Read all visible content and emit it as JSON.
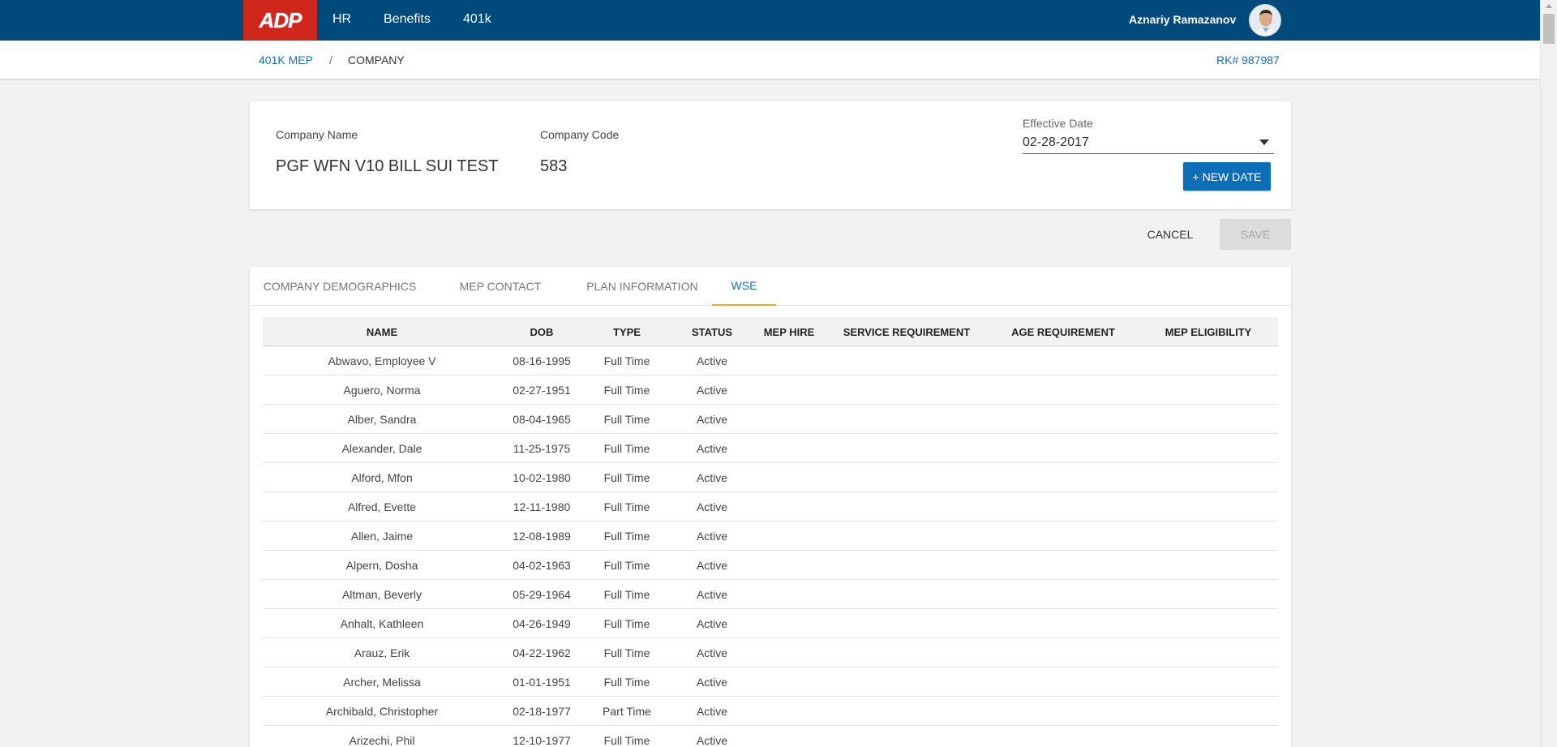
{
  "topbar": {
    "logo": "ADP",
    "nav": [
      "HR",
      "Benefits",
      "401k"
    ],
    "user_name": "Aznariy Ramazanov"
  },
  "breadcrumb": {
    "root": "401K MEP",
    "separator": "/",
    "current": "COMPANY",
    "rk": "RK# 987987"
  },
  "company": {
    "name_label": "Company Name",
    "name_value": "PGF WFN V10 BILL SUI TEST",
    "code_label": "Company Code",
    "code_value": "583",
    "effective_label": "Effective Date",
    "effective_value": "02-28-2017",
    "new_date_label": "+ NEW DATE"
  },
  "actions": {
    "cancel": "CANCEL",
    "save": "SAVE"
  },
  "tabs": [
    {
      "label": "COMPANY DEMOGRAPHICS",
      "active": false
    },
    {
      "label": "MEP CONTACT",
      "active": false
    },
    {
      "label": "PLAN INFORMATION",
      "active": false
    },
    {
      "label": "WSE",
      "active": true
    }
  ],
  "table": {
    "columns": [
      "NAME",
      "DOB",
      "TYPE",
      "STATUS",
      "MEP HIRE",
      "SERVICE REQUIREMENT",
      "AGE REQUIREMENT",
      "MEP ELIGIBILITY"
    ],
    "rows": [
      [
        "Abwavo, Employee V",
        "08-16-1995",
        "Full Time",
        "Active",
        "",
        "",
        "",
        ""
      ],
      [
        "Aguero, Norma",
        "02-27-1951",
        "Full Time",
        "Active",
        "",
        "",
        "",
        ""
      ],
      [
        "Alber, Sandra",
        "08-04-1965",
        "Full Time",
        "Active",
        "",
        "",
        "",
        ""
      ],
      [
        "Alexander, Dale",
        "11-25-1975",
        "Full Time",
        "Active",
        "",
        "",
        "",
        ""
      ],
      [
        "Alford, Mfon",
        "10-02-1980",
        "Full Time",
        "Active",
        "",
        "",
        "",
        ""
      ],
      [
        "Alfred, Evette",
        "12-11-1980",
        "Full Time",
        "Active",
        "",
        "",
        "",
        ""
      ],
      [
        "Allen, Jaime",
        "12-08-1989",
        "Full Time",
        "Active",
        "",
        "",
        "",
        ""
      ],
      [
        "Alpern, Dosha",
        "04-02-1963",
        "Full Time",
        "Active",
        "",
        "",
        "",
        ""
      ],
      [
        "Altman, Beverly",
        "05-29-1964",
        "Full Time",
        "Active",
        "",
        "",
        "",
        ""
      ],
      [
        "Anhalt, Kathleen",
        "04-26-1949",
        "Full Time",
        "Active",
        "",
        "",
        "",
        ""
      ],
      [
        "Arauz, Erik",
        "04-22-1962",
        "Full Time",
        "Active",
        "",
        "",
        "",
        ""
      ],
      [
        "Archer, Melissa",
        "01-01-1951",
        "Full Time",
        "Active",
        "",
        "",
        "",
        ""
      ],
      [
        "Archibald, Christopher",
        "02-18-1977",
        "Part Time",
        "Active",
        "",
        "",
        "",
        ""
      ],
      [
        "Arizechi, Phil",
        "12-10-1977",
        "Full Time",
        "Active",
        "",
        "",
        "",
        ""
      ]
    ]
  }
}
